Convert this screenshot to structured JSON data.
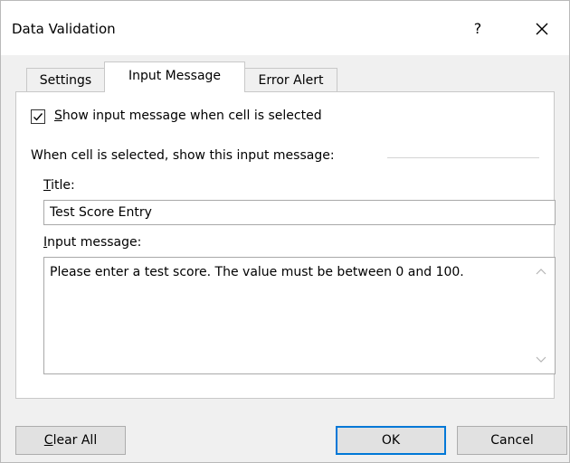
{
  "window": {
    "title": "Data Validation",
    "help_label": "?",
    "close_icon": "close-icon"
  },
  "tabs": [
    {
      "label": "Settings",
      "selected": false
    },
    {
      "label": "Input Message",
      "selected": true
    },
    {
      "label": "Error Alert",
      "selected": false
    }
  ],
  "input_message": {
    "show_checkbox": {
      "checked": true,
      "label_underlined": "S",
      "label_rest": "how input message when cell is selected"
    },
    "group_label": "When cell is selected, show this input message:",
    "title_label_underlined": "T",
    "title_label_rest": "itle:",
    "title_value": "Test Score Entry",
    "message_label_underlined": "I",
    "message_label_rest": "nput message:",
    "message_value": "Please enter a test score. The value must be between 0 and 100."
  },
  "buttons": {
    "clear_underlined": "C",
    "clear_rest": "lear All",
    "ok": "OK",
    "cancel": "Cancel"
  },
  "colors": {
    "default_button_border": "#0078d7",
    "dialog_bg": "#f0f0f0"
  }
}
